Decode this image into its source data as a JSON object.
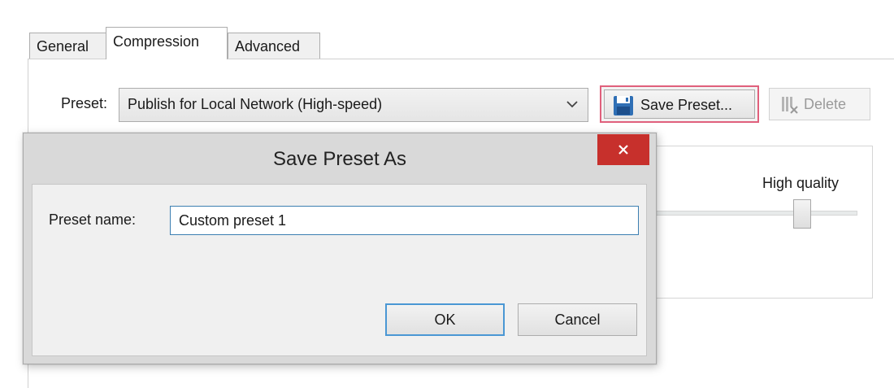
{
  "tabs": [
    {
      "label": "General",
      "active": false
    },
    {
      "label": "Compression",
      "active": true
    },
    {
      "label": "Advanced",
      "active": false
    }
  ],
  "compression": {
    "preset_label": "Preset:",
    "preset_value": "Publish for Local Network (High-speed)",
    "save_preset_label": "Save Preset...",
    "delete_label": "Delete",
    "high_quality_label": "High quality"
  },
  "dialog": {
    "title": "Save Preset As",
    "preset_name_label": "Preset name:",
    "preset_name_value": "Custom preset 1",
    "ok_label": "OK",
    "cancel_label": "Cancel"
  },
  "colors": {
    "highlight_border": "#e0607c",
    "close_button": "#c7302c",
    "focus_border": "#4a97d4"
  }
}
